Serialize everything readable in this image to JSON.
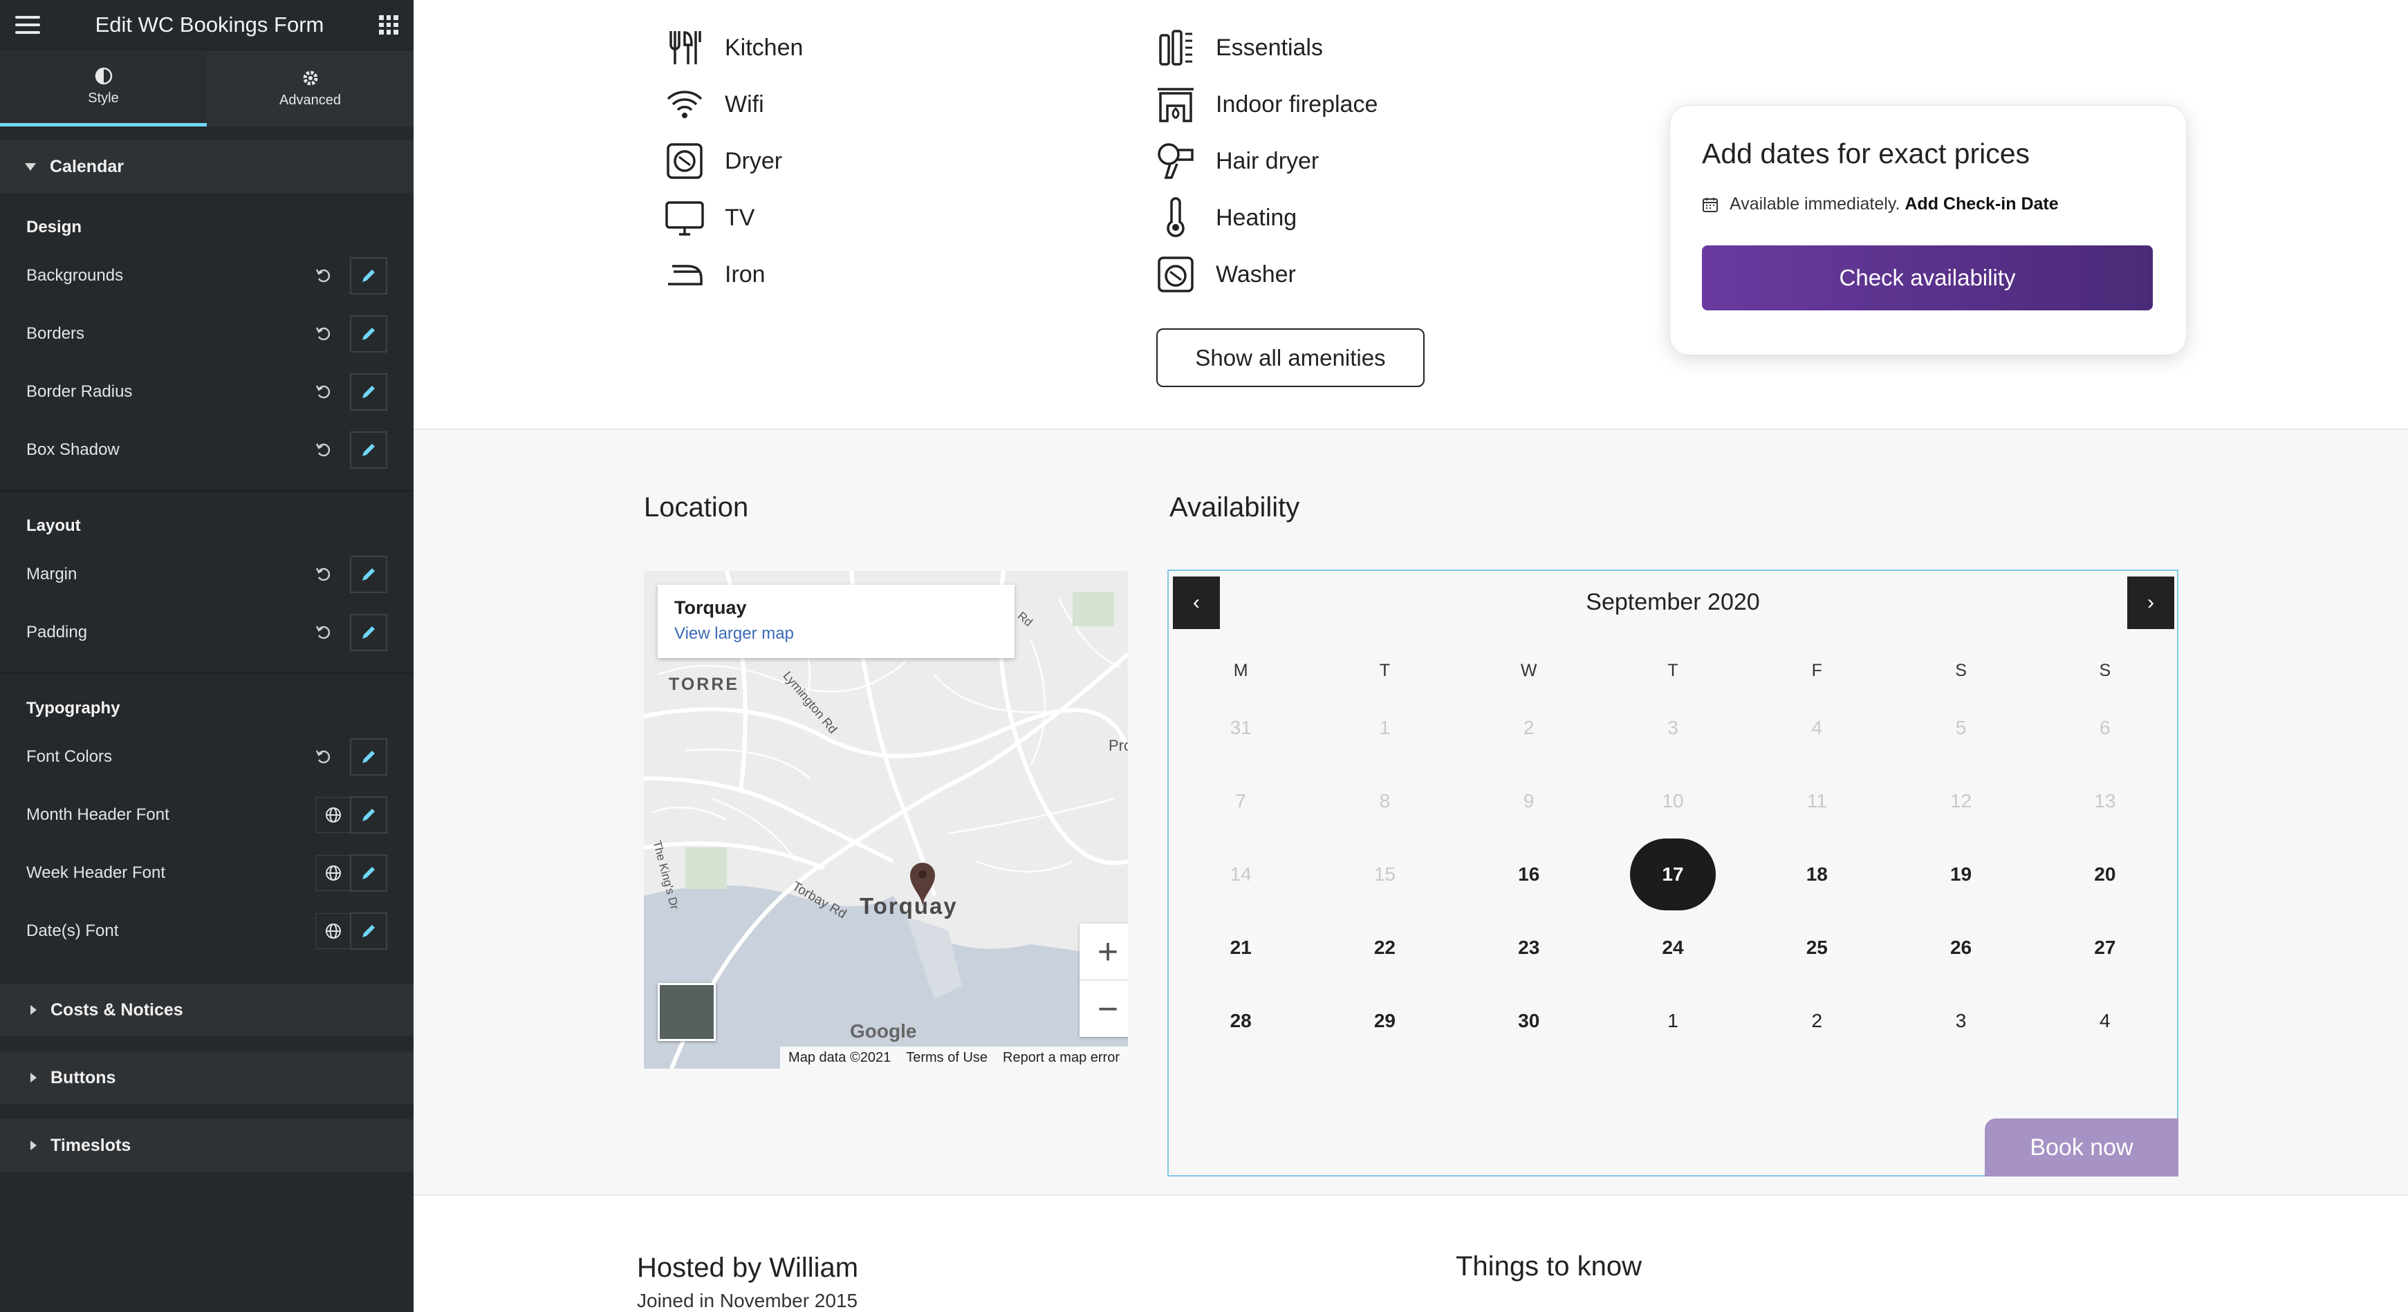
{
  "editor": {
    "title": "Edit WC Bookings Form",
    "tabs": [
      {
        "label": "Style",
        "icon": "contrast-icon",
        "active": true
      },
      {
        "label": "Advanced",
        "icon": "gear-icon",
        "active": false
      }
    ],
    "calendar_section": {
      "label": "Calendar",
      "groups": [
        {
          "label": "Design",
          "controls": [
            "Backgrounds",
            "Borders",
            "Border Radius",
            "Box Shadow"
          ]
        },
        {
          "label": "Layout",
          "controls": [
            "Margin",
            "Padding"
          ]
        },
        {
          "label": "Typography",
          "controls": [
            "Font Colors",
            "Month Header Font",
            "Week Header Font",
            "Date(s) Font"
          ]
        }
      ]
    },
    "collapsed_sections": [
      "Costs & Notices",
      "Buttons",
      "Timeslots"
    ]
  },
  "amenities": {
    "left": [
      "Kitchen",
      "Wifi",
      "Dryer",
      "TV",
      "Iron"
    ],
    "right": [
      "Essentials",
      "Indoor fireplace",
      "Hair dryer",
      "Heating",
      "Washer"
    ],
    "show_all_label": "Show all amenities"
  },
  "price_card": {
    "title": "Add dates for exact prices",
    "available_text": "Available immediately.",
    "checkin_link": "Add Check-in Date",
    "button_label": "Check availability",
    "accent": "#5b3290"
  },
  "location": {
    "title": "Location",
    "popup_title": "Torquay",
    "popup_link": "View larger map",
    "map_labels": {
      "torre": "TORRE",
      "town": "Torquay",
      "lymington": "Lymington Rd",
      "torbay": "Torbay Rd",
      "kings": "The King's Dr",
      "pro": "Pro",
      "rd": "Rd",
      "google": "Google"
    },
    "zoom_in": "+",
    "zoom_out": "−",
    "footer": [
      "Map data ©2021",
      "Terms of Use",
      "Report a map error"
    ]
  },
  "availability": {
    "title": "Availability",
    "month": "September 2020",
    "prev": "‹",
    "next": "›",
    "weekdays": [
      "M",
      "T",
      "W",
      "T",
      "F",
      "S",
      "S"
    ],
    "weeks": [
      [
        "31",
        "1",
        "2",
        "3",
        "4",
        "5",
        "6"
      ],
      [
        "7",
        "8",
        "9",
        "10",
        "11",
        "12",
        "13"
      ],
      [
        "14",
        "15",
        "16",
        "17",
        "18",
        "19",
        "20"
      ],
      [
        "21",
        "22",
        "23",
        "24",
        "25",
        "26",
        "27"
      ],
      [
        "28",
        "29",
        "30",
        "1",
        "2",
        "3",
        "4"
      ]
    ],
    "selected_day": "17",
    "book_now": "Book now"
  },
  "host": {
    "title": "Hosted by William",
    "joined": "Joined in November 2015"
  },
  "things_to_know": "Things to know"
}
